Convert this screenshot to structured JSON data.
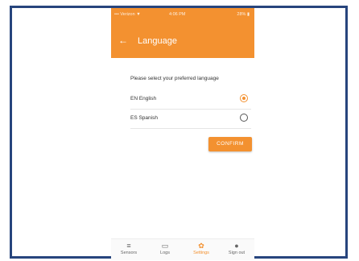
{
  "status_bar": {
    "carrier": "Verizon",
    "time": "4:06 PM",
    "battery": "28%"
  },
  "header": {
    "title": "Language",
    "back_icon": "arrow-left-icon"
  },
  "content": {
    "prompt": "Please select your preferred language",
    "options": [
      {
        "label": "EN English",
        "selected": true
      },
      {
        "label": "ES Spanish",
        "selected": false
      }
    ],
    "confirm_label": "CONFIRM"
  },
  "tabs": [
    {
      "label": "Sensors",
      "icon": "menu-lines-icon",
      "active": false
    },
    {
      "label": "Logs",
      "icon": "folder-icon",
      "active": false
    },
    {
      "label": "Settings",
      "icon": "gear-icon",
      "active": true
    },
    {
      "label": "Sign out",
      "icon": "person-icon",
      "active": false
    }
  ],
  "colors": {
    "accent": "#f39130",
    "frame_border": "#27457d"
  }
}
